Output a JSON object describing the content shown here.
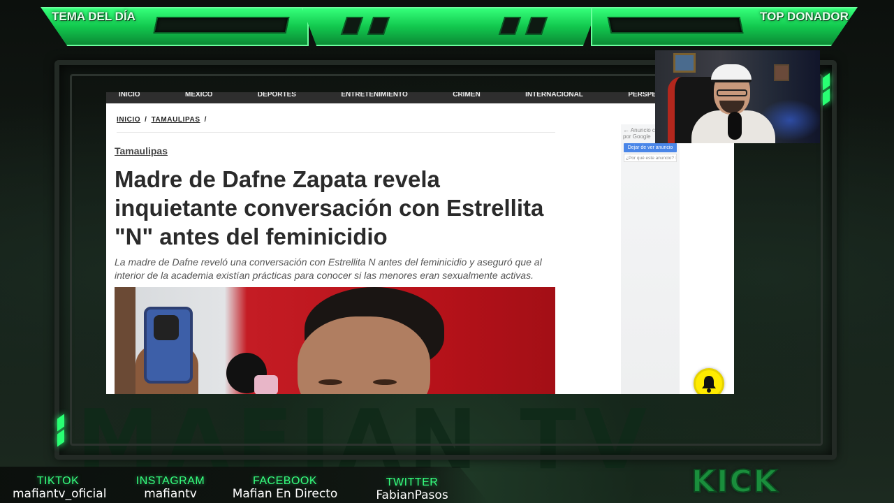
{
  "overlay": {
    "tema_label": "TEMA DEL DÍA",
    "top_label": "TOP DONADOR",
    "kick_label": "KICK",
    "background_text": "MAFIAN TV",
    "colors": {
      "accent": "#29ff73",
      "dark": "#0b0f0c"
    }
  },
  "browser": {
    "nav_items": [
      "INICIO",
      "MÉXICO",
      "DEPORTES",
      "ENTRETENIMIENTO",
      "CRIMEN",
      "INTERNACIONAL",
      "PERSPECTIVA"
    ],
    "breadcrumb": {
      "home": "INICIO",
      "section": "TAMAULIPAS",
      "separator": "/"
    },
    "section_label": "Tamaulipas",
    "headline": "Madre de Dafne Zapata revela inquietante conversación con Estrellita \"N\" antes del feminicidio",
    "summary": "La madre de Dafne reveló una conversación con Estrellita N antes del feminicidio y aseguró que al interior de la academia existían prácticas para conocer si las menores eran sexualmente activas.",
    "ad": {
      "top_text": "Anuncio cerrado por Google",
      "stop_button": "Dejar de ver anuncio",
      "why_button": "¿Por qué este anuncio? ⓘ"
    },
    "bell_icon": "notification-bell-icon",
    "bell_color": "#ffeb00"
  },
  "socials": [
    {
      "label": "TIKTOK",
      "handle": "mafiantv_oficial"
    },
    {
      "label": "INSTAGRAM",
      "handle": "mafiantv"
    },
    {
      "label": "FACEBOOK",
      "handle": "Mafian En Directo"
    },
    {
      "label": "TWITTER",
      "handle": "FabianPasos"
    }
  ]
}
